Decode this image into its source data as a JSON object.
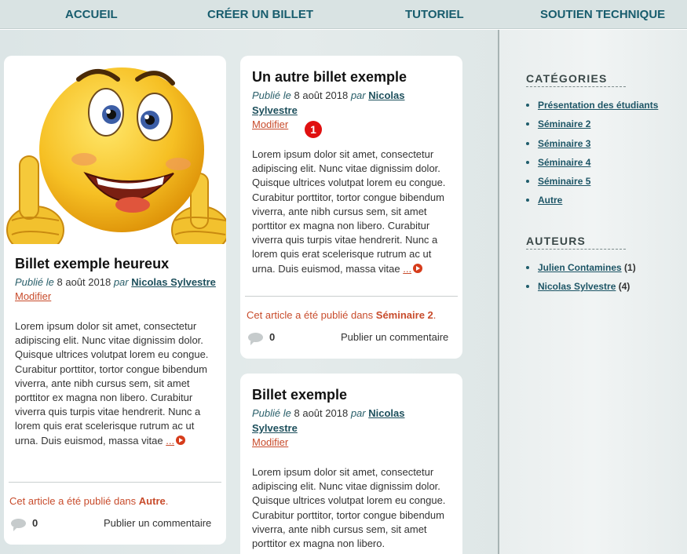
{
  "nav": {
    "items": [
      {
        "label": "ACCUEIL"
      },
      {
        "label": "CRÉER UN BILLET"
      },
      {
        "label": "TUTORIEL"
      },
      {
        "label": "SOUTIEN TECHNIQUE"
      }
    ]
  },
  "posts": [
    {
      "title": "Billet exemple heureux",
      "published_prefix": "Publié le",
      "date": "8 août 2018",
      "by": "par",
      "author": "Nicolas Sylvestre",
      "edit": "Modifier",
      "excerpt": "Lorem ipsum dolor sit amet, consectetur adipiscing elit. Nunc vitae dignissim dolor. Quisque ultrices volutpat lorem eu congue. Curabitur porttitor, tortor congue bibendum viverra, ante nibh cursus sem, sit amet porttitor ex magna non libero. Curabitur viverra quis turpis vitae hendrerit. Nunc a lorem quis erat scelerisque rutrum ac ut urna. Duis euismod, massa vitae",
      "more": "...",
      "published_in": "Cet article a été publié dans",
      "category": "Autre",
      "period": ".",
      "comment_count": "0",
      "comment_link": "Publier un commentaire",
      "image": "thumbs-up-smiley"
    },
    {
      "title": "Un autre billet exemple",
      "published_prefix": "Publié le",
      "date": "8 août 2018",
      "by": "par",
      "author": "Nicolas Sylvestre",
      "edit": "Modifier",
      "excerpt": "Lorem ipsum dolor sit amet, consectetur adipiscing elit. Nunc vitae dignissim dolor. Quisque ultrices volutpat lorem eu congue. Curabitur porttitor, tortor congue bibendum viverra, ante nibh cursus sem, sit amet porttitor ex magna non libero. Curabitur viverra quis turpis vitae hendrerit. Nunc a lorem quis erat scelerisque rutrum ac ut urna. Duis euismod, massa vitae",
      "more": "...",
      "published_in": "Cet article a été publié dans",
      "category": "Séminaire 2",
      "period": ".",
      "comment_count": "0",
      "comment_link": "Publier un commentaire"
    },
    {
      "title": "Billet exemple",
      "published_prefix": "Publié le",
      "date": "8 août 2018",
      "by": "par",
      "author": "Nicolas Sylvestre",
      "edit": "Modifier",
      "excerpt": "Lorem ipsum dolor sit amet, consectetur adipiscing elit. Nunc vitae dignissim dolor. Quisque ultrices volutpat lorem eu congue. Curabitur porttitor, tortor congue bibendum viverra, ante nibh cursus sem, sit amet porttitor ex magna non libero."
    }
  ],
  "badge": "1",
  "sidebar": {
    "categories_title": "CATÉGORIES",
    "categories": [
      {
        "label": "Présentation des étudiants"
      },
      {
        "label": "Séminaire 2"
      },
      {
        "label": "Séminaire 3"
      },
      {
        "label": "Séminaire 4"
      },
      {
        "label": "Séminaire 5"
      },
      {
        "label": "Autre"
      }
    ],
    "authors_title": "AUTEURS",
    "authors": [
      {
        "label": "Julien Contamines",
        "count": "(1)"
      },
      {
        "label": "Nicolas Sylvestre",
        "count": "(4)"
      }
    ]
  },
  "colors": {
    "accent": "#175c6d",
    "link_red": "#c84c2c",
    "badge_red": "#e01010"
  }
}
